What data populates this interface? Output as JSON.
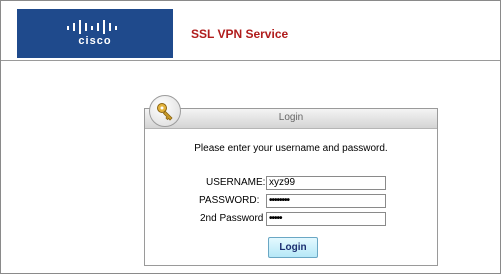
{
  "header": {
    "logo_text": "cisco",
    "service_title": "SSL VPN Service"
  },
  "login": {
    "title": "Login",
    "prompt": "Please enter your username and password.",
    "fields": {
      "username": {
        "label": "USERNAME:",
        "value": "xyz99"
      },
      "password": {
        "label": "PASSWORD:",
        "value": "••••••••"
      },
      "second_password": {
        "label": "2nd Password",
        "value": "•••••"
      }
    },
    "submit_label": "Login"
  },
  "icons": {
    "badge": "key-icon"
  },
  "colors": {
    "logo_bg": "#1f4a8c",
    "title_red": "#b01c1c",
    "button_bg": "#b6e8f7"
  }
}
